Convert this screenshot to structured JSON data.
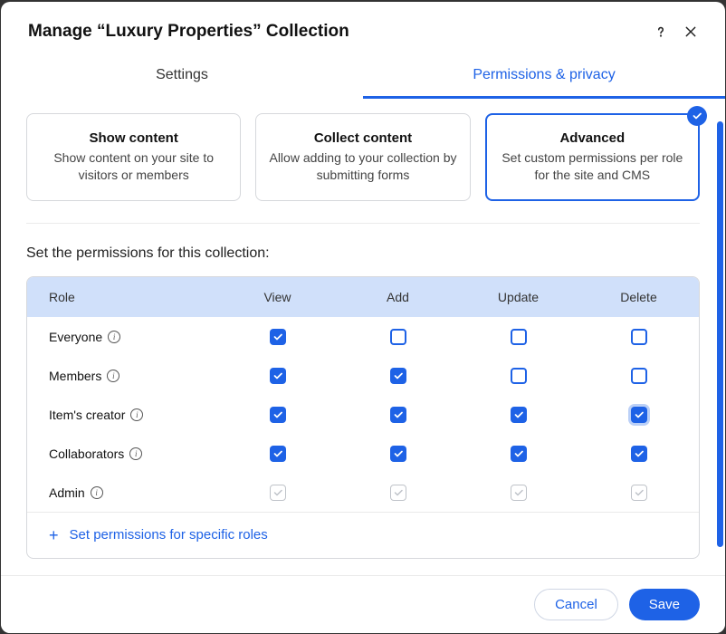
{
  "header": {
    "title": "Manage “Luxury Properties” Collection"
  },
  "tabs": [
    {
      "label": "Settings",
      "active": false
    },
    {
      "label": "Permissions & privacy",
      "active": true
    }
  ],
  "cards": [
    {
      "title": "Show content",
      "desc": "Show content on your site to visitors or members",
      "selected": false
    },
    {
      "title": "Collect content",
      "desc": "Allow adding to your collection by submitting forms",
      "selected": false
    },
    {
      "title": "Advanced",
      "desc": "Set custom permissions per role for the site and CMS",
      "selected": true
    }
  ],
  "section_title": "Set the permissions for this collection:",
  "table": {
    "headers": {
      "role": "Role",
      "view": "View",
      "add": "Add",
      "update": "Update",
      "delete": "Delete"
    },
    "rows": [
      {
        "role": "Everyone",
        "cells": [
          "checked",
          "unchecked",
          "unchecked",
          "unchecked"
        ]
      },
      {
        "role": "Members",
        "cells": [
          "checked",
          "checked",
          "unchecked",
          "unchecked"
        ]
      },
      {
        "role": "Item's creator",
        "cells": [
          "checked",
          "checked",
          "checked",
          "checked-focused"
        ]
      },
      {
        "role": "Collaborators",
        "cells": [
          "checked",
          "checked",
          "checked",
          "checked"
        ]
      },
      {
        "role": "Admin",
        "cells": [
          "disabled-checked",
          "disabled-checked",
          "disabled-checked",
          "disabled-checked"
        ]
      }
    ],
    "footer_link": "Set permissions for specific roles"
  },
  "footer": {
    "cancel": "Cancel",
    "save": "Save"
  }
}
